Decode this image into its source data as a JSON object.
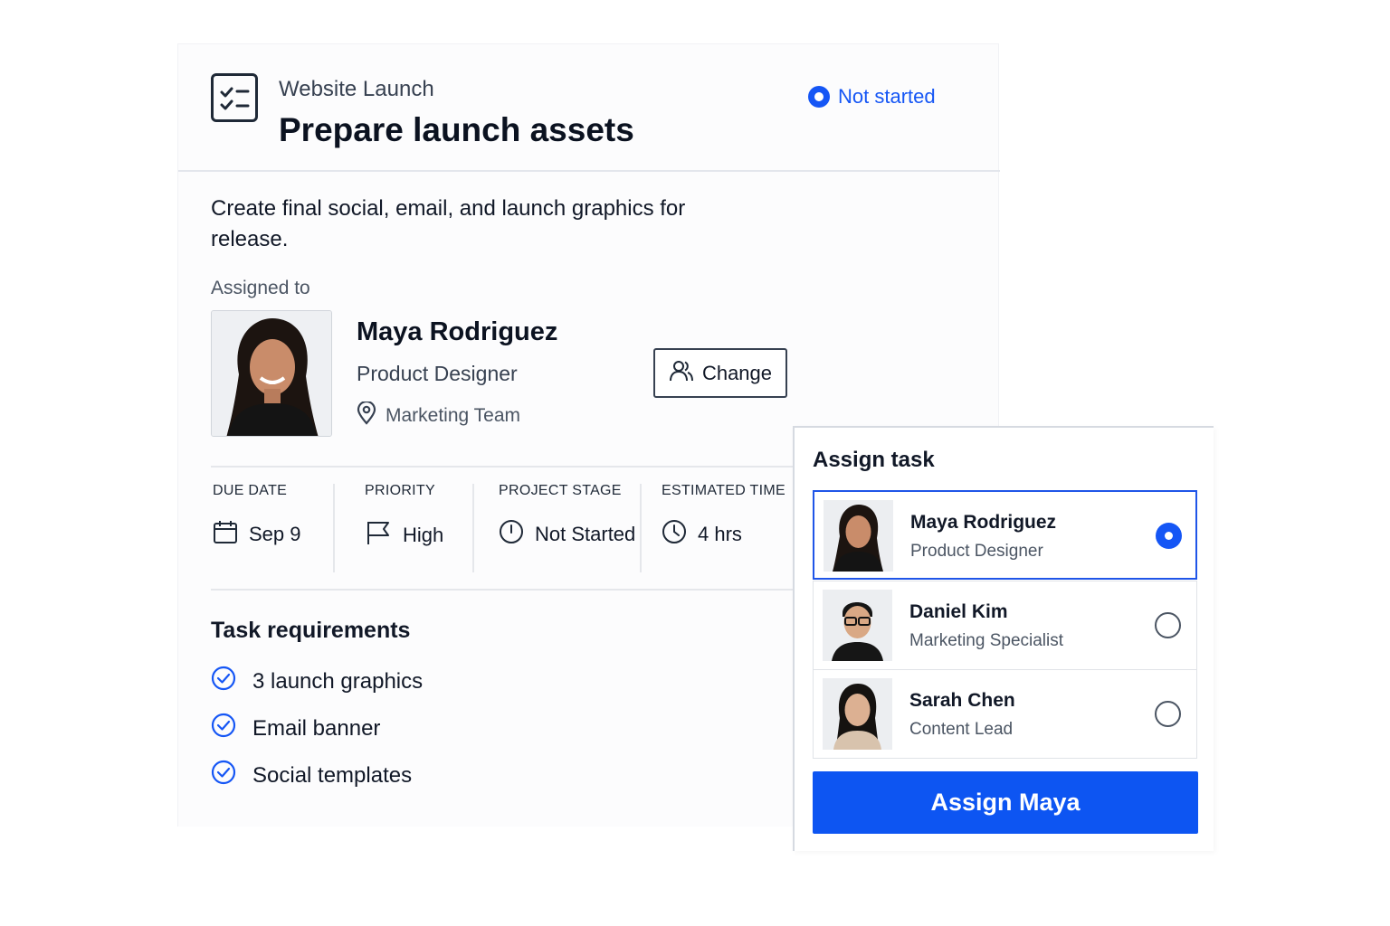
{
  "task": {
    "project": "Website Launch",
    "title": "Prepare launch assets",
    "status": "Not started",
    "description": "Create final social, email, and launch graphics for release.",
    "accent_color": "#1556f5"
  },
  "assignee": {
    "label": "Assigned to",
    "name": "Maya Rodriguez",
    "role": "Product Designer",
    "team": "Marketing Team",
    "change_label": "Change"
  },
  "meta": [
    {
      "label": "DUE DATE",
      "value": "Sep 9",
      "icon": "calendar-icon"
    },
    {
      "label": "PRIORITY",
      "value": "High",
      "icon": "flag-icon"
    },
    {
      "label": "PROJECT STAGE",
      "value": "Not Started",
      "icon": "stage-clock-icon"
    },
    {
      "label": "ESTIMATED TIME",
      "value": "4 hrs",
      "icon": "clock-icon"
    }
  ],
  "requirements": {
    "title": "Task requirements",
    "items": [
      "3 launch graphics",
      "Email banner",
      "Social templates"
    ]
  },
  "assign_panel": {
    "title": "Assign task",
    "people": [
      {
        "name": "Maya Rodriguez",
        "role": "Product Designer",
        "selected": true
      },
      {
        "name": "Daniel Kim",
        "role": "Marketing Specialist",
        "selected": false
      },
      {
        "name": "Sarah Chen",
        "role": "Content Lead",
        "selected": false
      }
    ],
    "button_label": "Assign Maya"
  }
}
